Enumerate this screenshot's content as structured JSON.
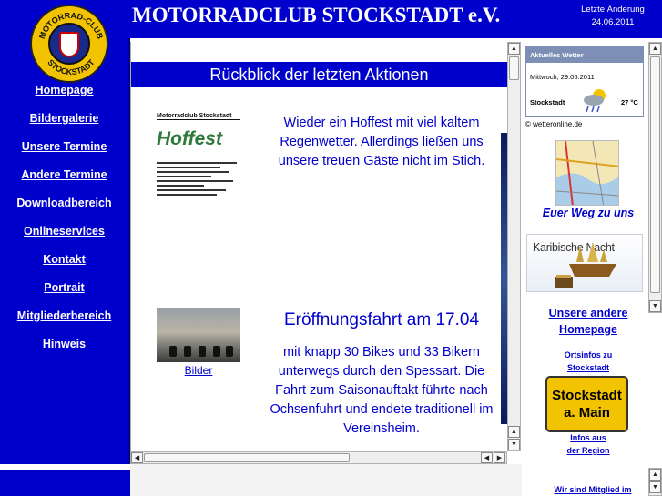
{
  "header": {
    "title": "MOTORRADCLUB STOCKSTADT e.V.",
    "last_change_label": "Letzte Änderung",
    "last_change_date": "24.06.2011"
  },
  "logo": {
    "top_text": "MOTORRAD-CLUB",
    "bottom_text": "STOCKSTADT"
  },
  "nav": {
    "items": [
      {
        "label": "Homepage"
      },
      {
        "label": "Bildergalerie"
      },
      {
        "label": "Unsere Termine"
      },
      {
        "label": "Andere Termine"
      },
      {
        "label": "Downloadbereich"
      },
      {
        "label": "Onlineservices"
      },
      {
        "label": "Kontakt"
      },
      {
        "label": "Portrait"
      },
      {
        "label": "Mitgliederbereich"
      },
      {
        "label": "Hinweis"
      }
    ]
  },
  "content": {
    "banner": "Rückblick der letzten Aktionen",
    "news1": {
      "poster_title": "Hoffest",
      "poster_org": "Motorradclub Stockstadt",
      "text": "Wieder ein Hoffest mit viel kaltem Regenwetter. Allerdings ließen uns unsere treuen Gäste nicht im Stich."
    },
    "news2": {
      "link": "Bilder",
      "title": "Eröffnungsfahrt am 17.04",
      "text": "mit knapp 30 Bikes und 33 Bikern unterwegs durch den Spessart. Die Fahrt zum Saisonauftakt führte nach Ochsenfuhrt und endete traditionell im Vereinsheim."
    }
  },
  "weather": {
    "header": "Aktuelles Wetter",
    "date": "Mittwoch, 29.06.2011",
    "city": "Stockstadt",
    "temp": "27 °C",
    "credit": "© wetteronline.de",
    "icon": "rain-sun-icon"
  },
  "right": {
    "directions": "Euer Weg zu uns",
    "karibik": "Karibische Nacht",
    "other_homepage_line1": "Unsere andere",
    "other_homepage_line2": "Homepage",
    "ortsinfos_line1": "Ortsinfos zu",
    "ortsinfos_line2": "Stockstadt",
    "badge_line1": "Stockstadt",
    "badge_line2": "a. Main",
    "region_line1": "Infos aus",
    "region_line2": "der Region",
    "member": "Wir sind Mitglied im"
  },
  "colors": {
    "brand_blue": "#0000cc",
    "logo_yellow": "#f2c300",
    "weather_header": "#7e8fb6"
  }
}
